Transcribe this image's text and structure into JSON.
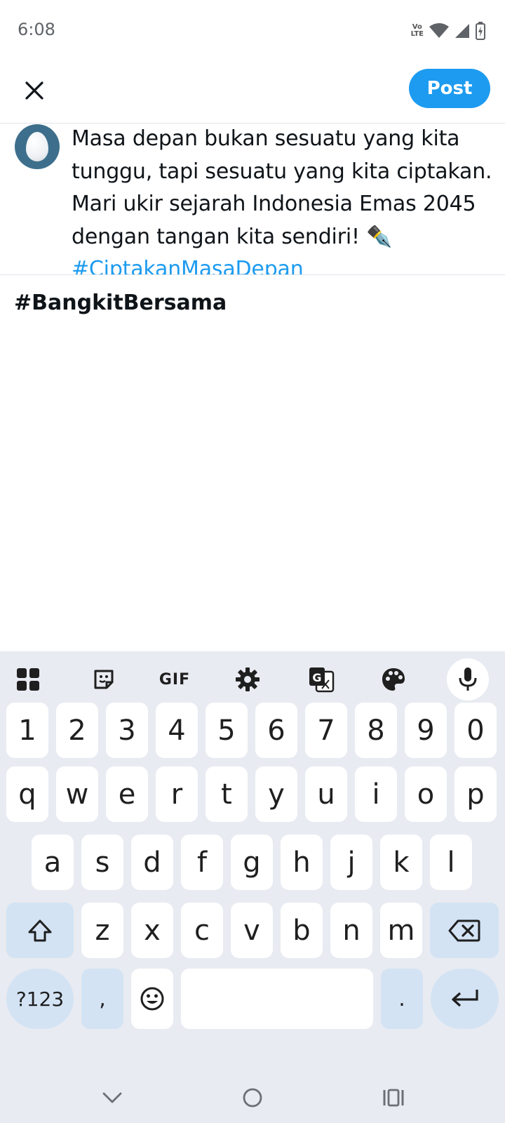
{
  "status_bar": {
    "time": "6:08",
    "volte_top": "Vo",
    "volte_bottom": "LTE"
  },
  "header": {
    "post_label": "Post"
  },
  "quoted_tweet": {
    "lines": [
      "Masa depan bukan sesuatu yang kita",
      "tunggu, tapi sesuatu yang kita ciptakan.",
      "Mari ukir sejarah Indonesia Emas 2045",
      "dengan tangan kita sendiri! ✒️"
    ],
    "hashtag": "#CiptakanMasaDepan"
  },
  "draft": {
    "text": "#BangkitBersama"
  },
  "keyboard": {
    "toolbar": {
      "gif_label": "GIF"
    },
    "row_numbers": [
      "1",
      "2",
      "3",
      "4",
      "5",
      "6",
      "7",
      "8",
      "9",
      "0"
    ],
    "row_1": [
      "q",
      "w",
      "e",
      "r",
      "t",
      "y",
      "u",
      "i",
      "o",
      "p"
    ],
    "row_2": [
      "a",
      "s",
      "d",
      "f",
      "g",
      "h",
      "j",
      "k",
      "l"
    ],
    "row_3": [
      "z",
      "x",
      "c",
      "v",
      "b",
      "n",
      "m"
    ],
    "symbols_label": "?123",
    "comma_label": ",",
    "period_label": "."
  }
}
